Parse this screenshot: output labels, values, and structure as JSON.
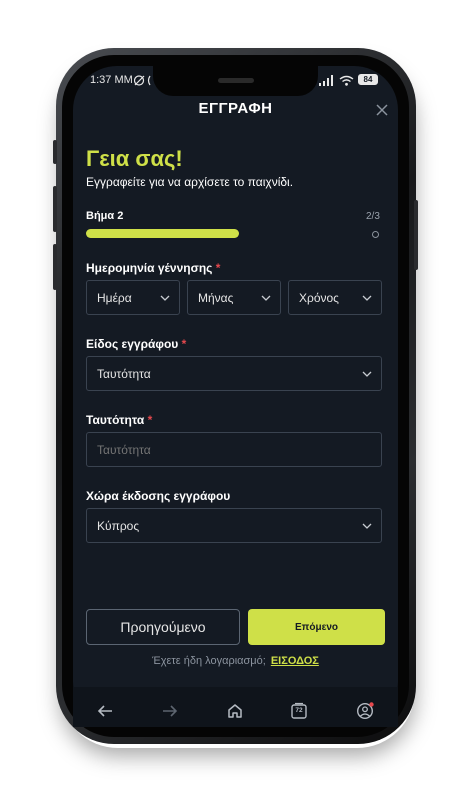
{
  "status_bar": {
    "time": "1:37 ΜΜ",
    "battery": "84"
  },
  "header": {
    "title": "ΕΓΓΡΑΦΗ"
  },
  "greeting": {
    "title": "Γεια σας!",
    "subtitle": "Εγγραφείτε για να αρχίσετε το παιχνίδι."
  },
  "progress": {
    "step_label": "Βήμα 2",
    "count": "2/3",
    "fraction": 0.5
  },
  "birth_date": {
    "label": "Ημερομηνία γέννησης",
    "required": "*",
    "day": "Ημέρα",
    "month": "Μήνας",
    "year": "Χρόνος"
  },
  "document_type": {
    "label": "Είδος εγγράφου",
    "required": "*",
    "value": "Ταυτότητα"
  },
  "id_field": {
    "label": "Ταυτότητα",
    "required": "*",
    "placeholder": "Ταυτότητα"
  },
  "issue_country": {
    "label": "Χώρα έκδοσης εγγράφου",
    "value": "Κύπρος"
  },
  "buttons": {
    "previous": "Προηγούμενο",
    "next": "Επόμενο"
  },
  "footer": {
    "question": "Έχετε ήδη λογαριασμό;",
    "login_link": "ΕΙΣΟΔΟΣ"
  },
  "nav": {
    "tabs_count": "72"
  },
  "colors": {
    "accent": "#cfe048",
    "background": "#141a23",
    "required": "#e5484d"
  }
}
